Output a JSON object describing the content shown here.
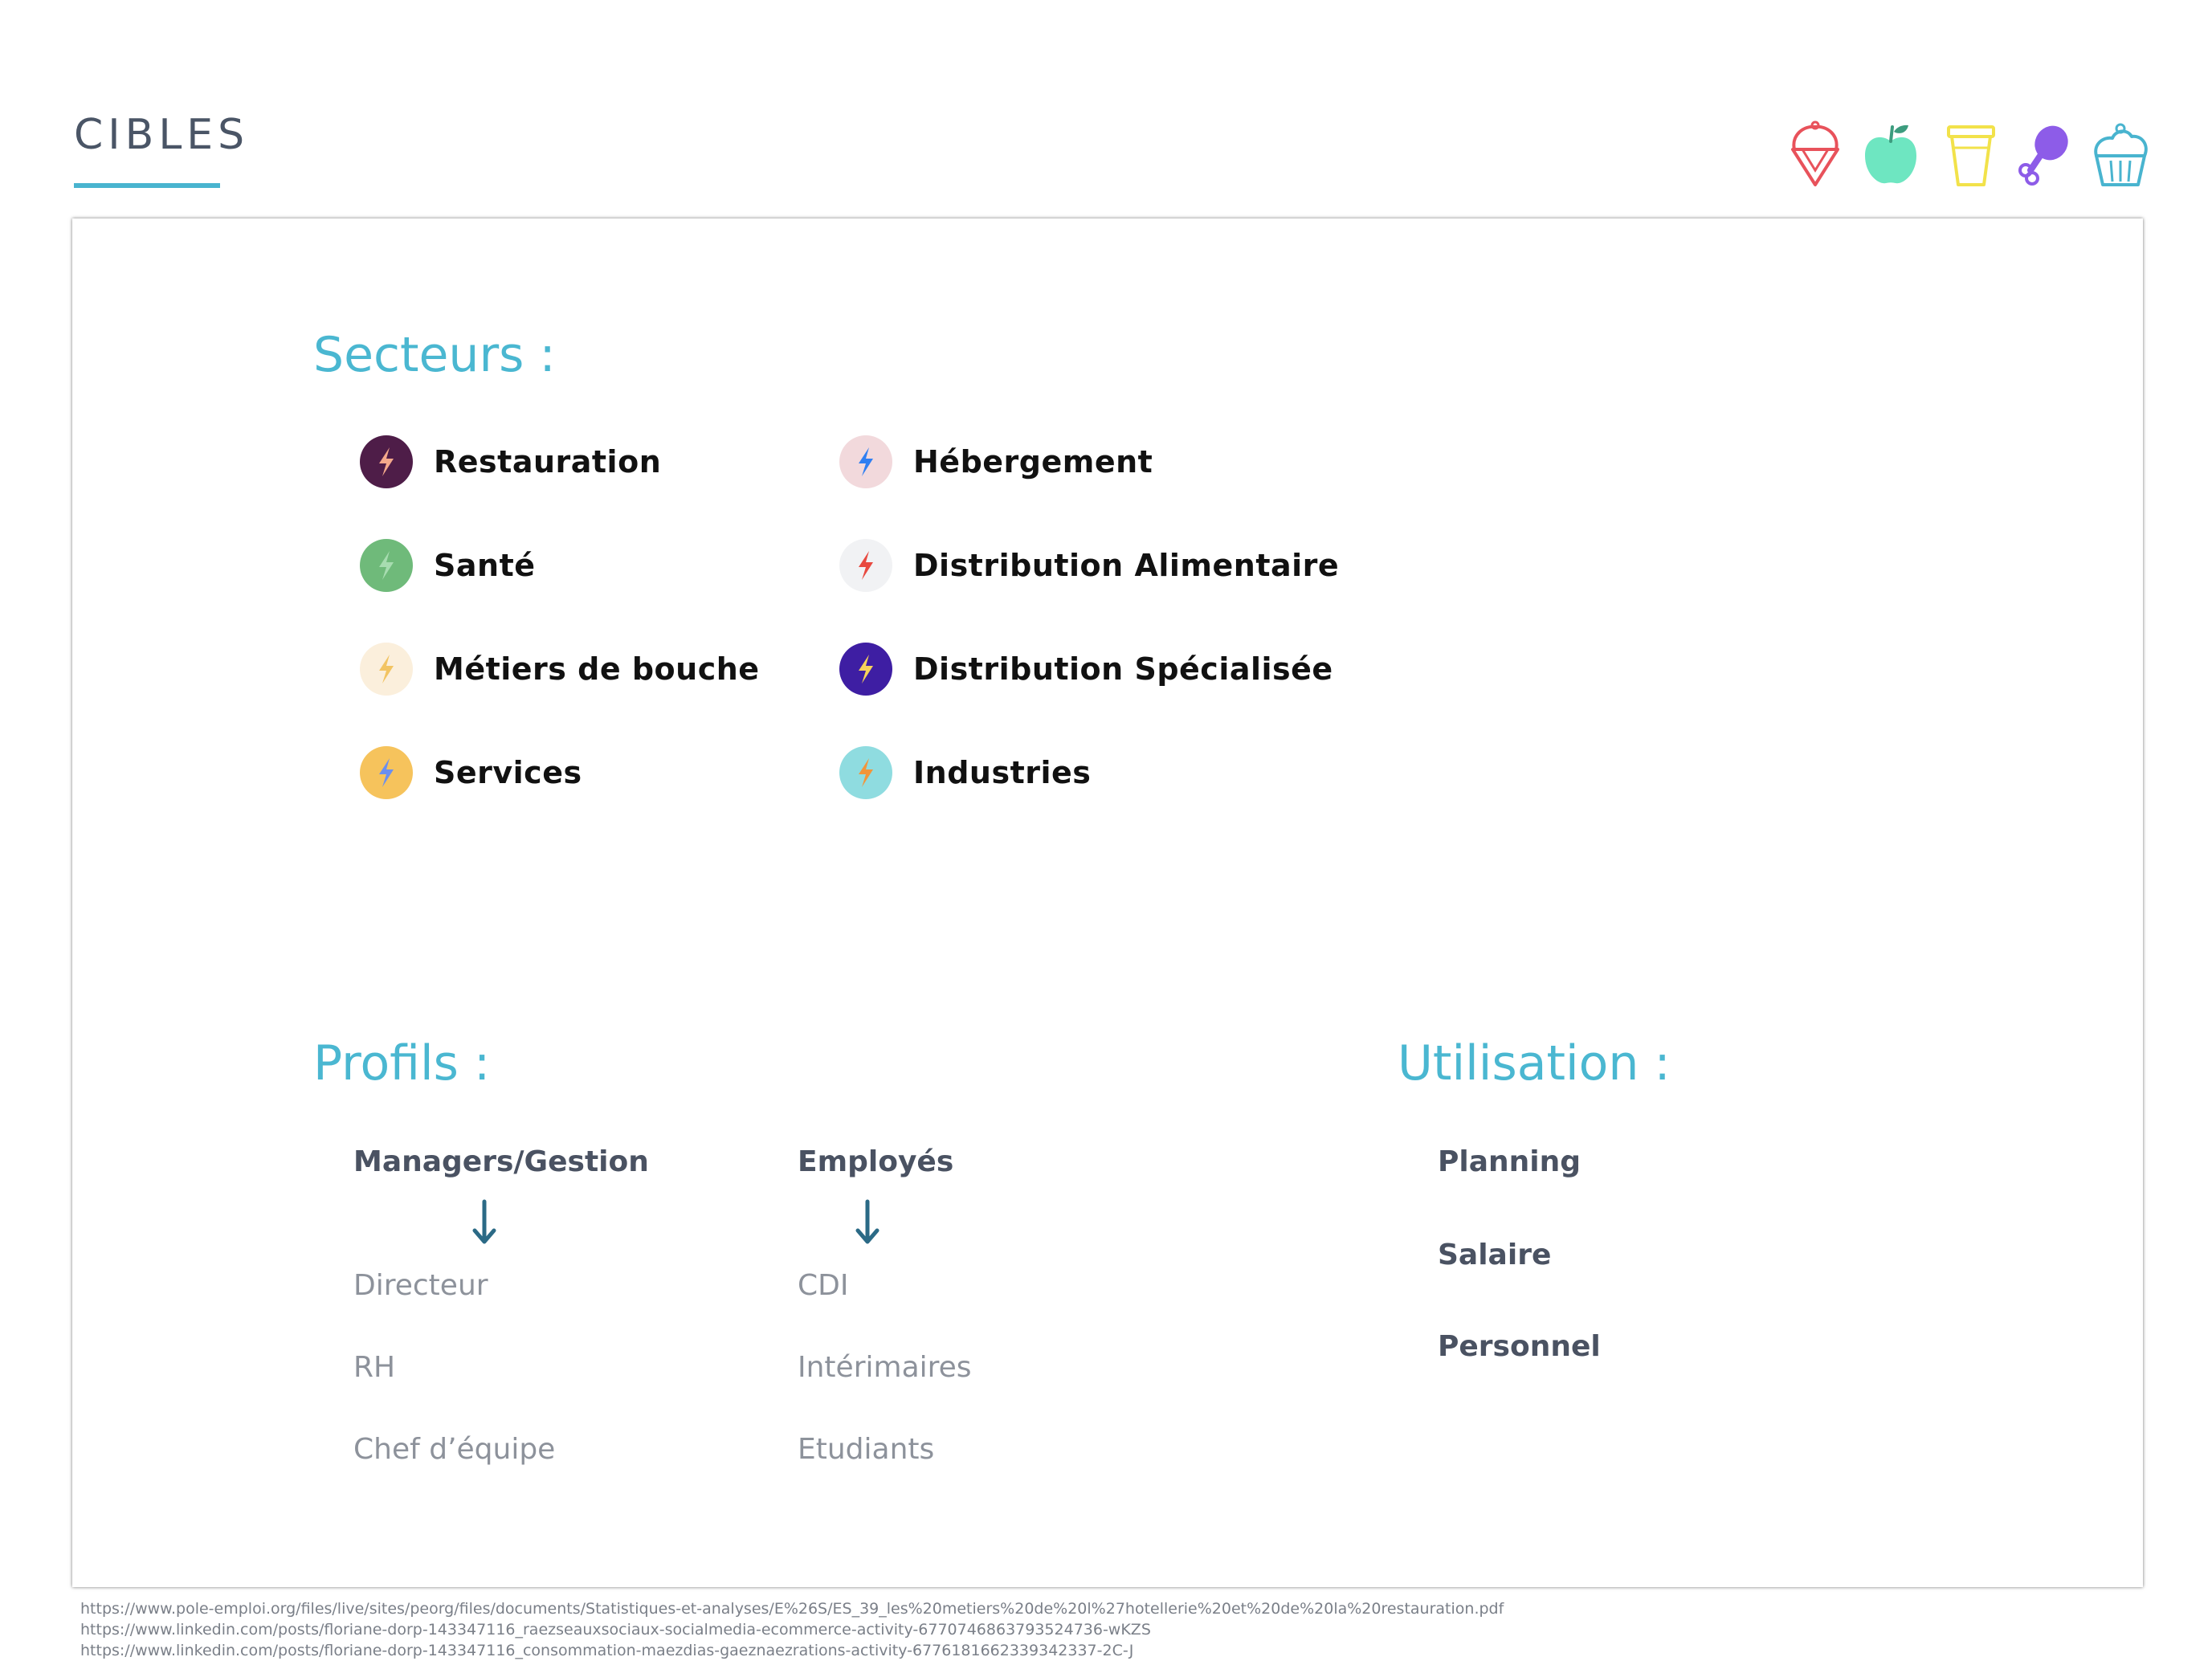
{
  "header": {
    "title": "CIBLES",
    "accent_color": "#49b4cf",
    "icons": [
      {
        "name": "ice-cream-icon",
        "color": "#e8525b"
      },
      {
        "name": "apple-icon",
        "color": "#6ee6c1"
      },
      {
        "name": "cup-icon",
        "color": "#f2e24a"
      },
      {
        "name": "drumstick-icon",
        "color": "#8d5ce8"
      },
      {
        "name": "cupcake-icon",
        "color": "#49b4cf"
      }
    ]
  },
  "sectors": {
    "heading": "Secteurs :",
    "items": [
      {
        "label": "Restauration",
        "badge_color": "#4e1d48",
        "bolt_color": "#f4a98b"
      },
      {
        "label": "Santé",
        "badge_color": "#6fba7a",
        "bolt_color": "#a7dcb0"
      },
      {
        "label": "Métiers de bouche",
        "badge_color": "#fbefdc",
        "bolt_color": "#f2c462"
      },
      {
        "label": "Services",
        "badge_color": "#f6c35c",
        "bolt_color": "#6a8ff0"
      },
      {
        "label": "Hébergement",
        "badge_color": "#f2d9dc",
        "bolt_color": "#2f7ff2"
      },
      {
        "label": "Distribution Alimentaire",
        "badge_color": "#f1f2f4",
        "bolt_color": "#e8493f"
      },
      {
        "label": "Distribution Spécialisée",
        "badge_color": "#3e1ea3",
        "bolt_color": "#f6d35a"
      },
      {
        "label": "Industries",
        "badge_color": "#8fdce0",
        "bolt_color": "#f2953a"
      }
    ]
  },
  "profiles": {
    "heading": "Profils :",
    "arrow_color": "#2b6a86",
    "managers": {
      "title": "Managers/Gestion",
      "items": [
        "Directeur",
        "RH",
        "Chef d’équipe"
      ]
    },
    "employees": {
      "title": "Employés",
      "items": [
        "CDI",
        "Intérimaires",
        "Etudiants"
      ]
    }
  },
  "usage": {
    "heading": "Utilisation :",
    "items": [
      "Planning",
      "Salaire",
      "Personnel"
    ]
  },
  "sources": [
    "https://www.pole-emploi.org/files/live/sites/peorg/files/documents/Statistiques-et-analyses/E%26S/ES_39_les%20metiers%20de%20l%27hotellerie%20et%20de%20la%20restauration.pdf",
    "https://www.linkedin.com/posts/floriane-dorp-143347116_raezseauxsociaux-socialmedia-ecommerce-activity-6770746863793524736-wKZS",
    "https://www.linkedin.com/posts/floriane-dorp-143347116_consommation-maezdias-gaeznaezrations-activity-6776181662339342337-2C-J"
  ]
}
